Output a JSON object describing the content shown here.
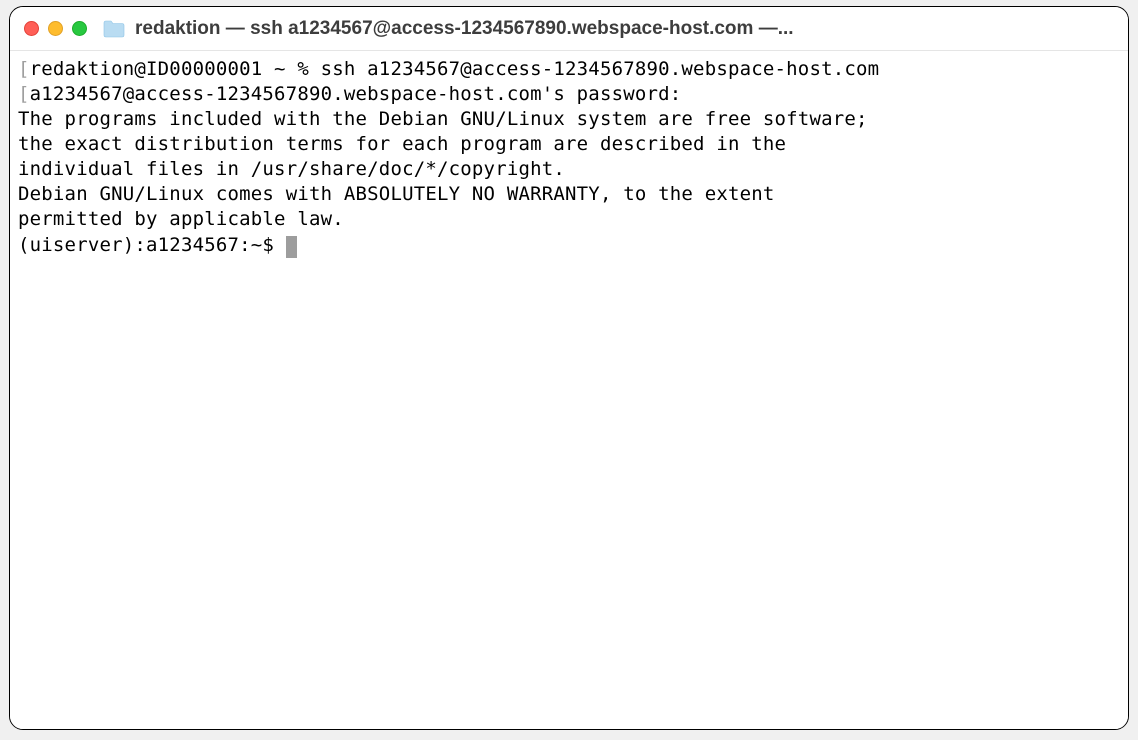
{
  "titlebar": {
    "title": "redaktion — ssh a1234567@access-1234567890.webspace-host.com —..."
  },
  "terminal": {
    "lines": {
      "l1_open": "[",
      "l1_body": "redaktion@ID00000001 ~ % ssh a1234567@access-1234567890.webspace-host.com",
      "l2_open": "[",
      "l2_body": "a1234567@access-1234567890.webspace-host.com's password:",
      "l3": "",
      "l4": "The programs included with the Debian GNU/Linux system are free software;",
      "l5": "the exact distribution terms for each program are described in the",
      "l6": "individual files in /usr/share/doc/*/copyright.",
      "l7": "",
      "l8": "Debian GNU/Linux comes with ABSOLUTELY NO WARRANTY, to the extent",
      "l9": "permitted by applicable law.",
      "l10_prompt": "(uiserver):a1234567:~$ "
    }
  }
}
